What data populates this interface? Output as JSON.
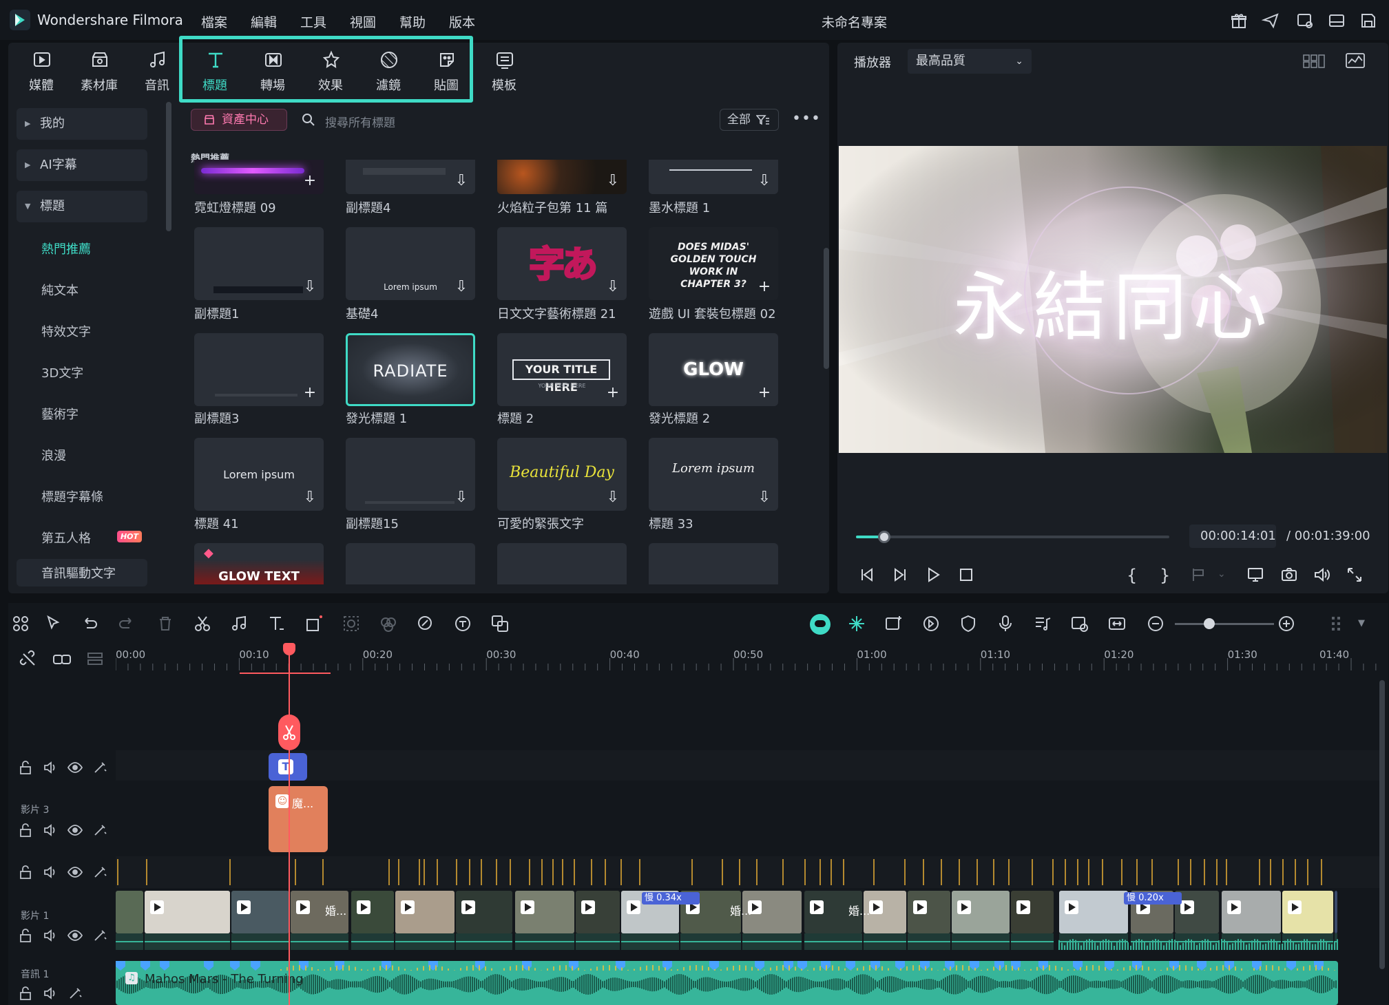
{
  "app": {
    "title": "Wondershare Filmora",
    "project": "未命名專案"
  },
  "menu": [
    "檔案",
    "編輯",
    "工具",
    "視圖",
    "幫助",
    "版本"
  ],
  "toolbar": [
    {
      "label": "媒體",
      "icon": "media-icon"
    },
    {
      "label": "素材庫",
      "icon": "stock-icon"
    },
    {
      "label": "音訊",
      "icon": "music-note-icon"
    },
    {
      "label": "標題",
      "icon": "title-t-icon",
      "active": true
    },
    {
      "label": "轉場",
      "icon": "transition-icon"
    },
    {
      "label": "效果",
      "icon": "effects-star-icon"
    },
    {
      "label": "濾鏡",
      "icon": "filter-icon"
    },
    {
      "label": "貼圖",
      "icon": "sticker-icon"
    },
    {
      "label": "模板",
      "icon": "template-icon"
    }
  ],
  "sidebar": {
    "groups": [
      {
        "label": "我的"
      },
      {
        "label": "AI字幕"
      },
      {
        "label": "標題"
      }
    ],
    "sub": [
      "熱門推薦",
      "純文本",
      "特效文字",
      "3D文字",
      "藝術字",
      "浪漫",
      "標題字幕條",
      "第五人格"
    ],
    "hot": "HOT",
    "last": "音訊驅動文字"
  },
  "content": {
    "asset_center": "資產中心",
    "search_placeholder": "搜尋所有標題",
    "filter_all": "全部",
    "section": "熱門推薦",
    "row0": [
      "霓虹燈標題 09",
      "副標題4",
      "火焰粒子包第 11 篇",
      "墨水標題 1"
    ],
    "row1": [
      "副標題1",
      "基礎4",
      "日文文字藝術標題 21",
      "遊戲 UI 套裝包標題 02"
    ],
    "row2": [
      "副標題3",
      "發光標題 1",
      "標題 2",
      "發光標題 2"
    ],
    "row3": [
      "標題 41",
      "副標題15",
      "可愛的緊張文字",
      "標題 33"
    ],
    "thumb": {
      "lorem": "Lorem ipsum",
      "jp": "字あ",
      "midas": "DOES MIDAS' GOLDEN TOUCH WORK IN CHAPTER 3?",
      "radiate": "RADIATE",
      "yourtitle": "YOUR TITLE HERE",
      "yourtext": "YOUR TEXT HERE",
      "glow": "GLOW",
      "beautiful": "Beautiful Day",
      "lorem_script": "Lorem ipsum",
      "glowtext": "GLOW TEXT"
    }
  },
  "player": {
    "label": "播放器",
    "quality": "最高品質",
    "overlay_text": "永結同心",
    "progress": 0.09,
    "current": "00:00:14:01",
    "total": "/ 00:01:39:00"
  },
  "timeline": {
    "ruler": [
      "00:00",
      "00:10",
      "00:20",
      "00:30",
      "00:40",
      "00:50",
      "01:00",
      "01:10",
      "01:20",
      "01:30",
      "01:40"
    ],
    "tracks": {
      "video3": "影片 3",
      "video1": "影片 1",
      "audio1": "音訊 1"
    },
    "title_clip": "T",
    "sticker_clip": "魔...",
    "speed1": "慢 0.34x",
    "speed2": "慢 0.20x",
    "clip_label": "婚...",
    "audio_name": "Mahos Mars - The Turning"
  },
  "colors": {
    "accent": "#3fdbc6",
    "playhead": "#ff5a5f",
    "title_clip": "#4a63d6",
    "sticker_clip": "#e1805c",
    "audio": "#37b59a"
  }
}
